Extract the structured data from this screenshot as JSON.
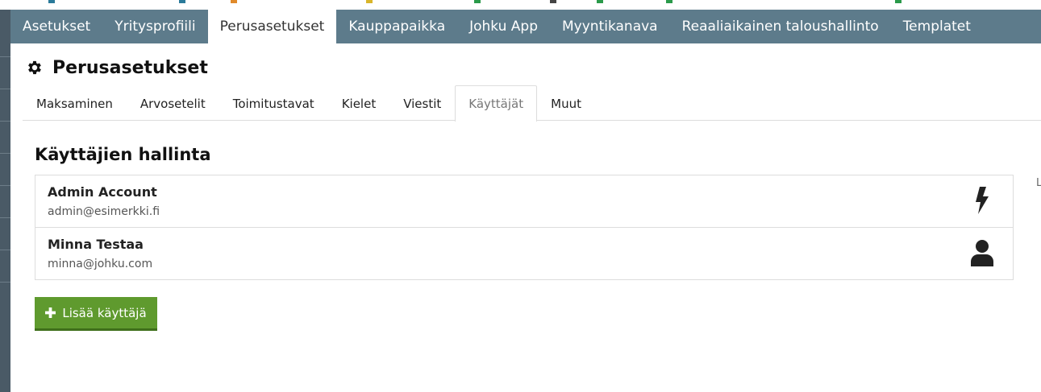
{
  "main_nav": {
    "items": [
      {
        "label": "Asetukset"
      },
      {
        "label": "Yritysprofiili"
      },
      {
        "label": "Perusasetukset"
      },
      {
        "label": "Kauppapaikka"
      },
      {
        "label": "Johku App"
      },
      {
        "label": "Myyntikanava"
      },
      {
        "label": "Reaaliaikainen taloushallinto"
      },
      {
        "label": "Templatet"
      }
    ],
    "active_index": 2,
    "background_color": "#5d7b8b"
  },
  "page": {
    "title": "Perusasetukset",
    "title_icon": "gear-icon"
  },
  "sub_tabs": {
    "items": [
      {
        "label": "Maksaminen"
      },
      {
        "label": "Arvosetelit"
      },
      {
        "label": "Toimitustavat"
      },
      {
        "label": "Kielet"
      },
      {
        "label": "Viestit"
      },
      {
        "label": "Käyttäjät"
      },
      {
        "label": "Muut"
      }
    ],
    "active_index": 5
  },
  "user_management": {
    "heading": "Käyttäjien hallinta",
    "users": [
      {
        "name": "Admin Account",
        "email": "admin@esimerkki.fi",
        "icon": "lightning-bolt-icon"
      },
      {
        "name": "Minna Testaa",
        "email": "minna@johku.com",
        "icon": "user-icon"
      }
    ],
    "add_button_label": "Lisää käyttäjä",
    "add_button_icon": "plus-icon",
    "add_button_color": "#5f9a2e"
  },
  "edge_glyph": "L"
}
